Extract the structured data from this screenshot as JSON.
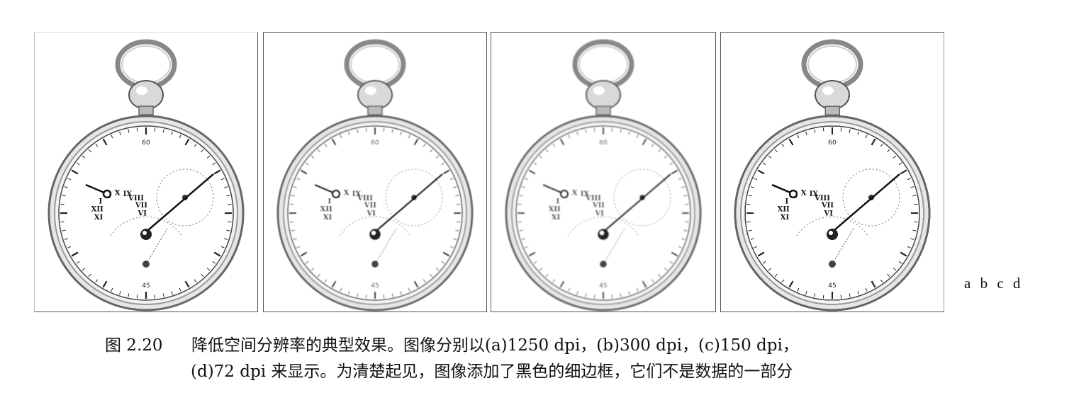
{
  "panels": [
    {
      "id": "a",
      "dpi": "1250 dpi"
    },
    {
      "id": "b",
      "dpi": "300 dpi"
    },
    {
      "id": "c",
      "dpi": "150 dpi"
    },
    {
      "id": "d",
      "dpi": "72 dpi"
    }
  ],
  "panel_letters": "a b c d",
  "dial": {
    "top": "60",
    "bottom": "45",
    "roman_left": [
      "XI",
      "XII",
      "I",
      "II",
      "X",
      "IX",
      "VIII",
      "VII",
      "VI"
    ]
  },
  "caption": {
    "figure_number": "图 2.20",
    "line1": "降低空间分辨率的典型效果。图像分别以(a)1250 dpi，(b)300 dpi，(c)150 dpi，",
    "line2": "(d)72 dpi 来显示。为清楚起见，图像添加了黑色的细边框，它们不是数据的一部分"
  }
}
